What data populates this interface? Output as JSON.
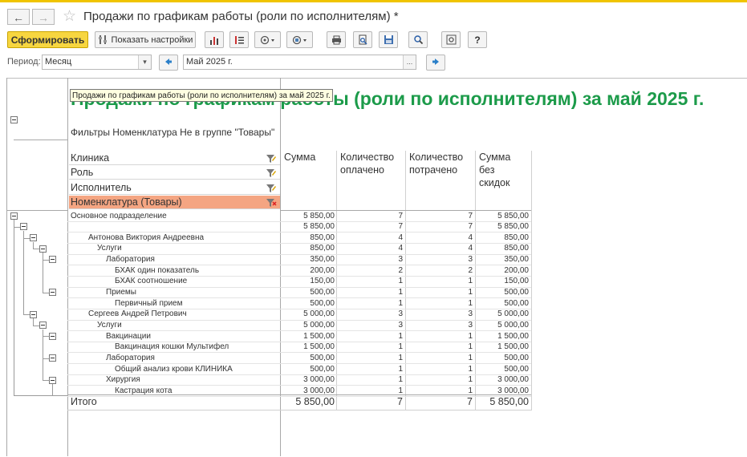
{
  "window": {
    "title": "Продажи по графикам работы (роли по исполнителям) *",
    "back_icon": "←",
    "forward_icon": "→",
    "favorite_icon": "☆"
  },
  "toolbar": {
    "generate_label": "Сформировать",
    "settings_label": "Показать настройки",
    "help_label": "?"
  },
  "period": {
    "label": "Период:",
    "type_value": "Месяц",
    "dropdown_glyph": "▾",
    "value": "Май 2025 г.",
    "select_glyph": "..."
  },
  "report": {
    "title": "Продажи по графикам работы (роли по исполнителям) за май 2025 г.",
    "tooltip": "Продажи по графикам работы (роли по исполнителям) за май 2025 г.",
    "filters": "Фильтры Номенклатура Не в группе \"Товары\"",
    "dimensions": [
      "Клиника",
      "Роль",
      "Исполнитель",
      "Номенклатура (Товары)"
    ],
    "columns": [
      "Сумма",
      "Количество оплачено",
      "Количество потрачено",
      "Сумма без скидок"
    ],
    "rows": [
      {
        "name": "Основное подразделение",
        "sum": "5 850,00",
        "paid": "7",
        "spent": "7",
        "nodisc": "5 850,00"
      },
      {
        "name": "",
        "sum": "5 850,00",
        "paid": "7",
        "spent": "7",
        "nodisc": "5 850,00"
      },
      {
        "name": "Антонова Виктория Андреевна",
        "sum": "850,00",
        "paid": "4",
        "spent": "4",
        "nodisc": "850,00"
      },
      {
        "name": "Услуги",
        "sum": "850,00",
        "paid": "4",
        "spent": "4",
        "nodisc": "850,00"
      },
      {
        "name": "Лаборатория",
        "sum": "350,00",
        "paid": "3",
        "spent": "3",
        "nodisc": "350,00"
      },
      {
        "name": "БХАК один показатель",
        "sum": "200,00",
        "paid": "2",
        "spent": "2",
        "nodisc": "200,00"
      },
      {
        "name": "БХАК соотношение",
        "sum": "150,00",
        "paid": "1",
        "spent": "1",
        "nodisc": "150,00"
      },
      {
        "name": "Приемы",
        "sum": "500,00",
        "paid": "1",
        "spent": "1",
        "nodisc": "500,00"
      },
      {
        "name": "Первичный прием",
        "sum": "500,00",
        "paid": "1",
        "spent": "1",
        "nodisc": "500,00"
      },
      {
        "name": "Сергеев Андрей Петрович",
        "sum": "5 000,00",
        "paid": "3",
        "spent": "3",
        "nodisc": "5 000,00"
      },
      {
        "name": "Услуги",
        "sum": "5 000,00",
        "paid": "3",
        "spent": "3",
        "nodisc": "5 000,00"
      },
      {
        "name": "Вакцинации",
        "sum": "1 500,00",
        "paid": "1",
        "spent": "1",
        "nodisc": "1 500,00"
      },
      {
        "name": "Вакцинация кошки Мультифел",
        "sum": "1 500,00",
        "paid": "1",
        "spent": "1",
        "nodisc": "1 500,00"
      },
      {
        "name": "Лаборатория",
        "sum": "500,00",
        "paid": "1",
        "spent": "1",
        "nodisc": "500,00"
      },
      {
        "name": "Общий анализ крови КЛИНИКА",
        "sum": "500,00",
        "paid": "1",
        "spent": "1",
        "nodisc": "500,00"
      },
      {
        "name": "Хирургия",
        "sum": "3 000,00",
        "paid": "1",
        "spent": "1",
        "nodisc": "3 000,00"
      },
      {
        "name": "Кастрация кота",
        "sum": "3 000,00",
        "paid": "1",
        "spent": "1",
        "nodisc": "3 000,00"
      }
    ],
    "total": {
      "name": "Итого",
      "sum": "5 850,00",
      "paid": "7",
      "spent": "7",
      "nodisc": "5 850,00"
    }
  },
  "colors": {
    "accent": "#f7d640",
    "title_green": "#1c9b4a",
    "highlight": "#f4a582"
  }
}
